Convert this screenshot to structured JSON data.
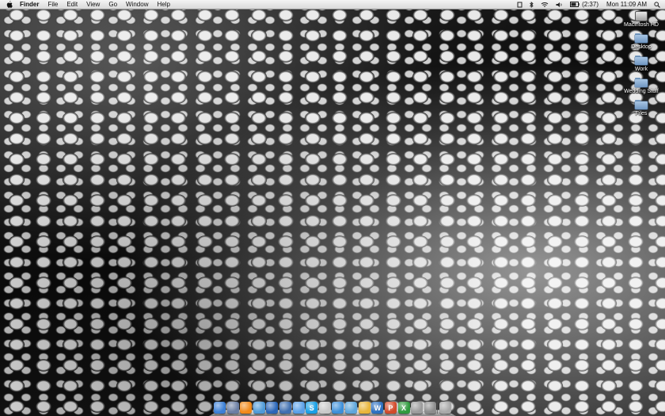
{
  "menubar": {
    "apple_icon": "apple-icon",
    "items": [
      {
        "label": "Finder",
        "app": true
      },
      {
        "label": "File"
      },
      {
        "label": "Edit"
      },
      {
        "label": "View"
      },
      {
        "label": "Go"
      },
      {
        "label": "Window"
      },
      {
        "label": "Help"
      }
    ],
    "status": {
      "battery_time": "(2:37)",
      "clock": "Mon 11:09 AM",
      "icons": [
        "script-icon",
        "bluetooth-icon",
        "wifi-icon",
        "volume-icon",
        "battery-icon",
        "spotlight-icon"
      ]
    }
  },
  "desktop_icons": [
    {
      "label": "Macintosh HD",
      "icon": "hard-disk-icon"
    },
    {
      "label": "Desktop",
      "icon": "folder-icon"
    },
    {
      "label": "Work",
      "icon": "folder-icon"
    },
    {
      "label": "Wedding Stuff",
      "icon": "folder-icon"
    },
    {
      "label": "Files",
      "icon": "folder-icon"
    }
  ],
  "dock": {
    "items": [
      {
        "name": "finder-icon",
        "color": "#3b7fd6",
        "glyph": ""
      },
      {
        "name": "launcher-icon",
        "color": "#6a7ea3",
        "glyph": ""
      },
      {
        "name": "vlc-icon",
        "color": "#f28a1a",
        "glyph": ""
      },
      {
        "name": "itunes-icon",
        "color": "#4e9ad8",
        "glyph": ""
      },
      {
        "name": "mail-icon",
        "color": "#2a66b8",
        "glyph": ""
      },
      {
        "name": "thunderbird-icon",
        "color": "#3f6fb0",
        "glyph": ""
      },
      {
        "name": "ichat-icon",
        "color": "#5aa0e8",
        "glyph": ""
      },
      {
        "name": "skype-icon",
        "color": "#19a0e6",
        "glyph": "S"
      },
      {
        "name": "calendar-icon",
        "color": "#c9c9c9",
        "glyph": ""
      },
      {
        "name": "safari-icon",
        "color": "#3c8fd9",
        "glyph": ""
      },
      {
        "name": "globe-icon",
        "color": "#5da6dc",
        "glyph": ""
      },
      {
        "name": "pen-icon",
        "color": "#e8b53a",
        "glyph": ""
      },
      {
        "name": "word-icon",
        "color": "#2c6fc0",
        "glyph": "W"
      },
      {
        "name": "powerpoint-icon",
        "color": "#d24a2a",
        "glyph": "P"
      },
      {
        "name": "excel-icon",
        "color": "#2f9a3d",
        "glyph": "X"
      },
      {
        "name": "preview-icon",
        "color": "#9b9b9b",
        "glyph": ""
      },
      {
        "name": "system-prefs-icon",
        "color": "#8c8c8c",
        "glyph": ""
      },
      {
        "name": "trash-icon",
        "color": "#a8a8a8",
        "glyph": ""
      }
    ]
  }
}
